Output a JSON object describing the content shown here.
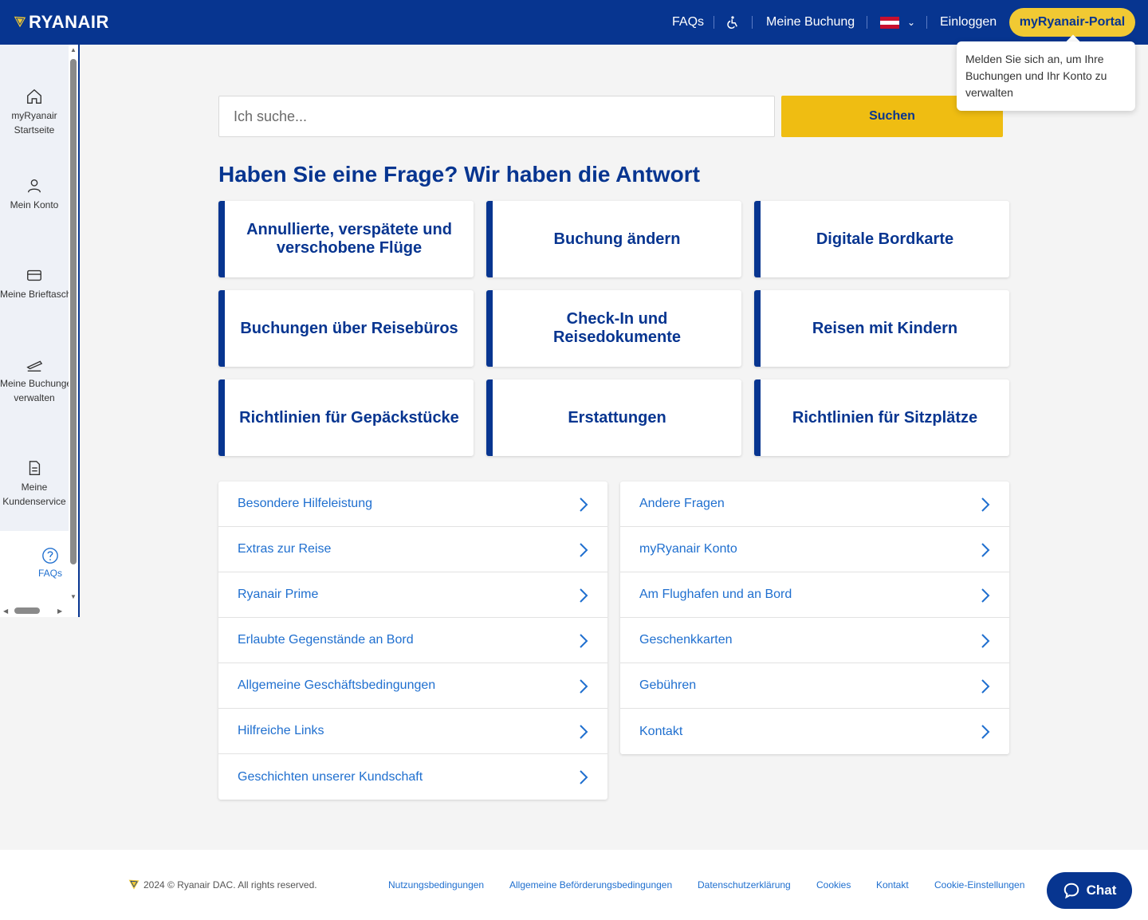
{
  "header": {
    "brand": "RYANAIR",
    "faqs": "FAQs",
    "my_booking": "Meine Buchung",
    "login": "Einloggen",
    "portal": "myRyanair-Portal",
    "tooltip": "Melden Sie sich an, um Ihre Buchungen und Ihr Konto zu verwalten",
    "flag_colors": [
      "#c8102e",
      "#ffffff",
      "#c8102e"
    ],
    "accent": "#073590",
    "yellow": "#f1c933"
  },
  "sidebar": {
    "items": [
      {
        "icon": "home-icon",
        "label1": "myRyanair",
        "label2": "Startseite"
      },
      {
        "icon": "user-icon",
        "label1": "Mein Konto",
        "label2": ""
      },
      {
        "icon": "wallet-icon",
        "label1": "Meine Brieftasche",
        "label2": ""
      },
      {
        "icon": "plane-departure-icon",
        "label1": "Meine Buchungen",
        "label2": "verwalten"
      },
      {
        "icon": "document-icon",
        "label1": "Meine",
        "label2": "Kundenservice"
      }
    ],
    "faq": "FAQs"
  },
  "search": {
    "placeholder": "Ich suche...",
    "button": "Suchen"
  },
  "main": {
    "title": "Haben Sie eine Frage? Wir haben die Antwort",
    "cards": [
      "Annullierte, verspätete und verschobene Flüge",
      "Buchung ändern",
      "Digitale Bordkarte",
      "Buchungen über Reisebüros",
      "Check-In und Reisedokumente",
      "Reisen mit Kindern",
      "Richtlinien für Gepäckstücke",
      "Erstattungen",
      "Richtlinien für Sitzplätze"
    ],
    "list_left": [
      "Besondere Hilfeleistung",
      "Extras zur Reise",
      "Ryanair Prime",
      "Erlaubte Gegenstände an Bord",
      "Allgemeine Geschäftsbedingungen",
      "Hilfreiche Links",
      "Geschichten unserer Kundschaft"
    ],
    "list_right": [
      "Andere Fragen",
      "myRyanair Konto",
      "Am Flughafen und an Bord",
      "Geschenkkarten",
      "Gebühren",
      "Kontakt"
    ]
  },
  "footer": {
    "copyright": "2024 © Ryanair DAC. All rights reserved.",
    "links": [
      "Nutzungsbedingungen",
      "Allgemeine Beförderungsbedingungen",
      "Datenschutzerklärung",
      "Cookies",
      "Kontakt",
      "Cookie-Einstellungen"
    ],
    "chat": "Chat"
  }
}
